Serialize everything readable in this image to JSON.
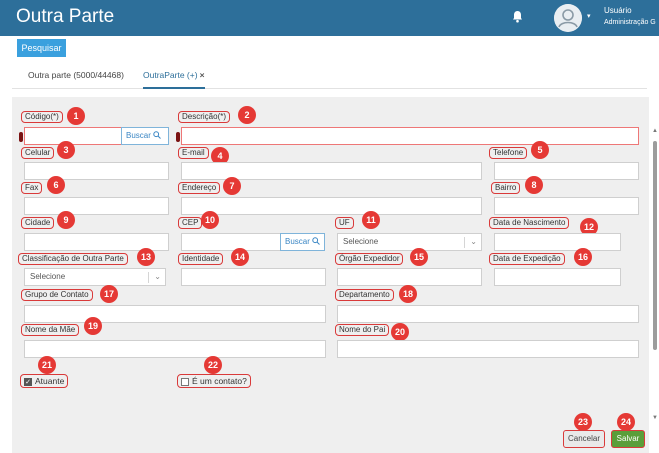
{
  "header": {
    "title": "Outra Parte",
    "user_name": "Usuário",
    "user_role": "Administração G"
  },
  "toolbar": {
    "search_label": "Pesquisar"
  },
  "tabs": [
    {
      "label": "Outra parte (5000/44468)"
    },
    {
      "label": "OutraParte (+)",
      "close": "×"
    }
  ],
  "form": {
    "codigo": {
      "label": "Código(*)",
      "value": "",
      "search_label": "Buscar"
    },
    "descricao": {
      "label": "Descrição(*)",
      "value": ""
    },
    "celular": {
      "label": "Celular",
      "value": ""
    },
    "email": {
      "label": "E-mail",
      "value": ""
    },
    "telefone": {
      "label": "Telefone",
      "value": ""
    },
    "fax": {
      "label": "Fax",
      "value": ""
    },
    "endereco": {
      "label": "Endereço",
      "value": ""
    },
    "bairro": {
      "label": "Bairro",
      "value": ""
    },
    "cidade": {
      "label": "Cidade",
      "value": ""
    },
    "cep": {
      "label": "CEP",
      "value": "",
      "search_label": "Buscar"
    },
    "uf": {
      "label": "UF",
      "selected": "Selecione"
    },
    "data_nascimento": {
      "label": "Data de Nascimento",
      "value": ""
    },
    "classificacao": {
      "label": "Classificação de Outra Parte",
      "selected": "Selecione"
    },
    "identidade": {
      "label": "Identidade",
      "value": ""
    },
    "orgao_expedidor": {
      "label": "Órgão Expedidor",
      "value": ""
    },
    "data_expedicao": {
      "label": "Data de Expedição",
      "value": ""
    },
    "grupo_contato": {
      "label": "Grupo de Contato",
      "value": ""
    },
    "departamento": {
      "label": "Departamento",
      "value": ""
    },
    "nome_mae": {
      "label": "Nome da Mãe",
      "value": ""
    },
    "nome_pai": {
      "label": "Nome do Pai",
      "value": ""
    },
    "atuante": {
      "label": "Atuante",
      "checked": true,
      "check_glyph": "✓"
    },
    "e_contato": {
      "label": "É um contato?",
      "checked": false
    }
  },
  "actions": {
    "cancel_label": "Cancelar",
    "save_label": "Salvar"
  },
  "badges": [
    "1",
    "2",
    "3",
    "4",
    "5",
    "6",
    "7",
    "8",
    "9",
    "10",
    "11",
    "12",
    "13",
    "14",
    "15",
    "16",
    "17",
    "18",
    "19",
    "20",
    "21",
    "22",
    "23",
    "24"
  ],
  "colors": {
    "header": "#2d6f9a",
    "primary": "#3aa0de",
    "save": "#5a9e3a",
    "badge": "#e53935"
  }
}
